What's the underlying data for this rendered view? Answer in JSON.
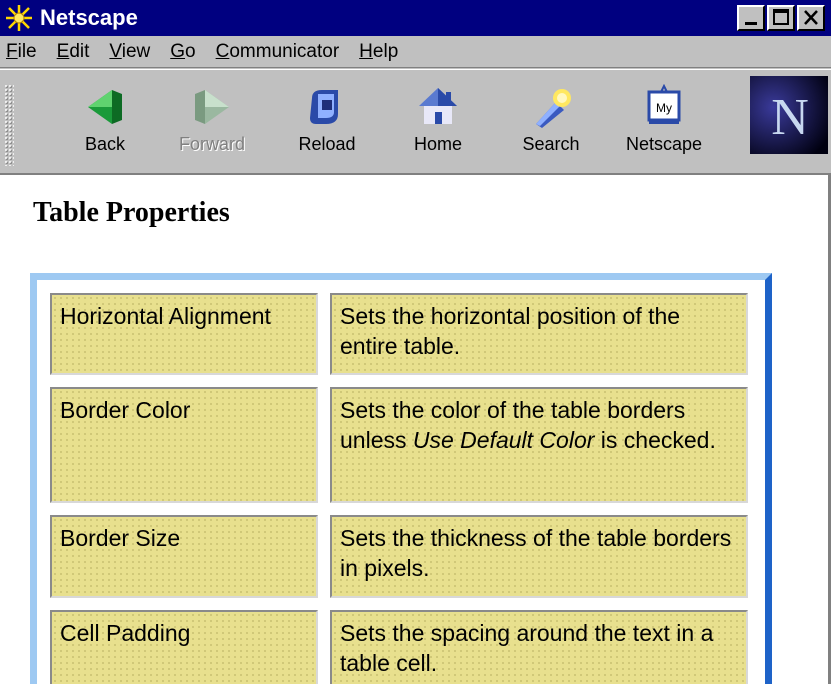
{
  "window": {
    "title": "Netscape",
    "title_color": "#000080"
  },
  "menu": [
    {
      "label": "File",
      "accel": "F",
      "rest": "ile"
    },
    {
      "label": "Edit",
      "accel": "E",
      "rest": "dit"
    },
    {
      "label": "View",
      "accel": "V",
      "rest": "iew"
    },
    {
      "label": "Go",
      "accel": "G",
      "rest": "o"
    },
    {
      "label": "Communicator",
      "accel": "C",
      "rest": "ommunicator"
    },
    {
      "label": "Help",
      "accel": "H",
      "rest": "elp"
    }
  ],
  "toolbar": {
    "back": "Back",
    "forward": "Forward",
    "reload": "Reload",
    "home": "Home",
    "search": "Search",
    "netscape": "Netscape",
    "my_badge": "My"
  },
  "page": {
    "title": "Table Properties",
    "rows": [
      {
        "name": "Horizontal Alignment",
        "desc": "Sets the horizontal position of the entire table."
      },
      {
        "name": "Border Color",
        "desc_pre": "Sets the color of the table borders unless ",
        "desc_italic": "Use Default Color",
        "desc_post": " is checked."
      },
      {
        "name": "Border Size",
        "desc": "Sets the thickness of the table borders in pixels."
      },
      {
        "name": "Cell Padding",
        "desc": "Sets the spacing around the text in a table cell."
      }
    ],
    "cell_color": "#e8e08e",
    "frame_light": "#9ec9f2",
    "frame_dark": "#1e63c8"
  }
}
